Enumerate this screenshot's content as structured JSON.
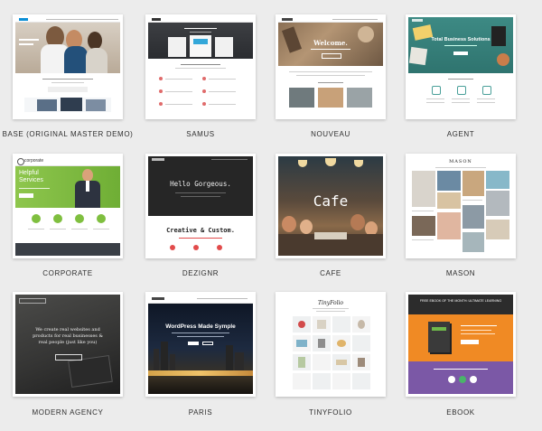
{
  "demos": [
    {
      "label": "BASE (ORIGINAL MASTER DEMO)",
      "thumb": {}
    },
    {
      "label": "SAMUS",
      "thumb": {}
    },
    {
      "label": "NOUVEAU",
      "thumb": {
        "headline": "Welcome."
      }
    },
    {
      "label": "AGENT",
      "thumb": {
        "headline": "Total Business Solutions"
      }
    },
    {
      "label": "CORPORATE",
      "thumb": {
        "brand": "corporate",
        "headline": "Helpful Services"
      }
    },
    {
      "label": "DEZIGNR",
      "thumb": {
        "headline": "Hello Gorgeous.",
        "subheadline": "Creative & Custom."
      }
    },
    {
      "label": "CAFE",
      "thumb": {
        "headline": "Cafe"
      }
    },
    {
      "label": "MASON",
      "thumb": {
        "brand": "MASON"
      }
    },
    {
      "label": "MODERN AGENCY",
      "thumb": {
        "headline": "We create real websites and products for real businesses & real people (just like you)"
      }
    },
    {
      "label": "PARIS",
      "thumb": {
        "headline": "WordPress Made Symple"
      }
    },
    {
      "label": "TINYFOLIO",
      "thumb": {
        "brand": "TinyFolio"
      }
    },
    {
      "label": "EBOOK",
      "thumb": {
        "headline": "FREE EBOOK OF THE MONTH: ULTIMATE LEARNING"
      }
    }
  ]
}
